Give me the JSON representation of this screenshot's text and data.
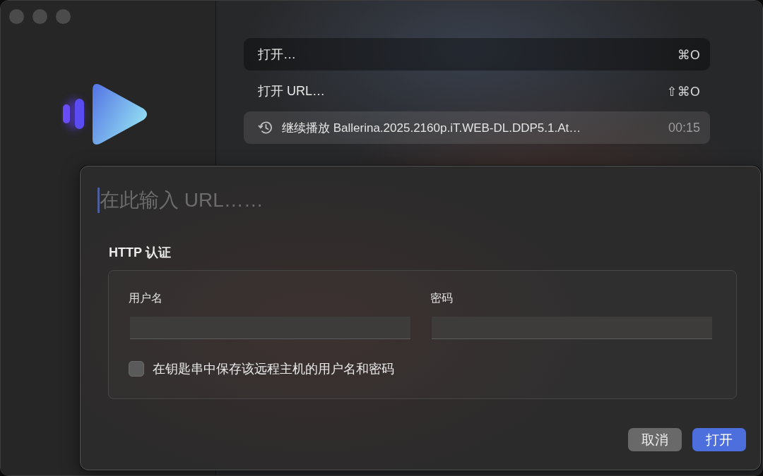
{
  "menu": {
    "items": [
      {
        "kind": "command",
        "label": "打开…",
        "shortcut": "⌘O",
        "selected": true
      },
      {
        "kind": "command",
        "label": "打开 URL…",
        "shortcut": "⇧⌘O",
        "selected": false
      },
      {
        "kind": "recent",
        "label": "继续播放 Ballerina.2025.2160p.iT.WEB-DL.DDP5.1.At…",
        "time": "00:15",
        "selected": false
      }
    ]
  },
  "url_dialog": {
    "url_field": {
      "placeholder": "在此输入 URL……",
      "focused": true
    },
    "auth": {
      "title": "HTTP 认证",
      "fields": [
        {
          "label": "用户名"
        },
        {
          "label": "密码"
        }
      ],
      "remember": {
        "label": "在钥匙串中保存该远程主机的用户名和密码",
        "checked": false
      }
    },
    "buttons": [
      {
        "kind": "cancel",
        "label": "取消"
      },
      {
        "kind": "default",
        "label": "打开"
      }
    ]
  }
}
